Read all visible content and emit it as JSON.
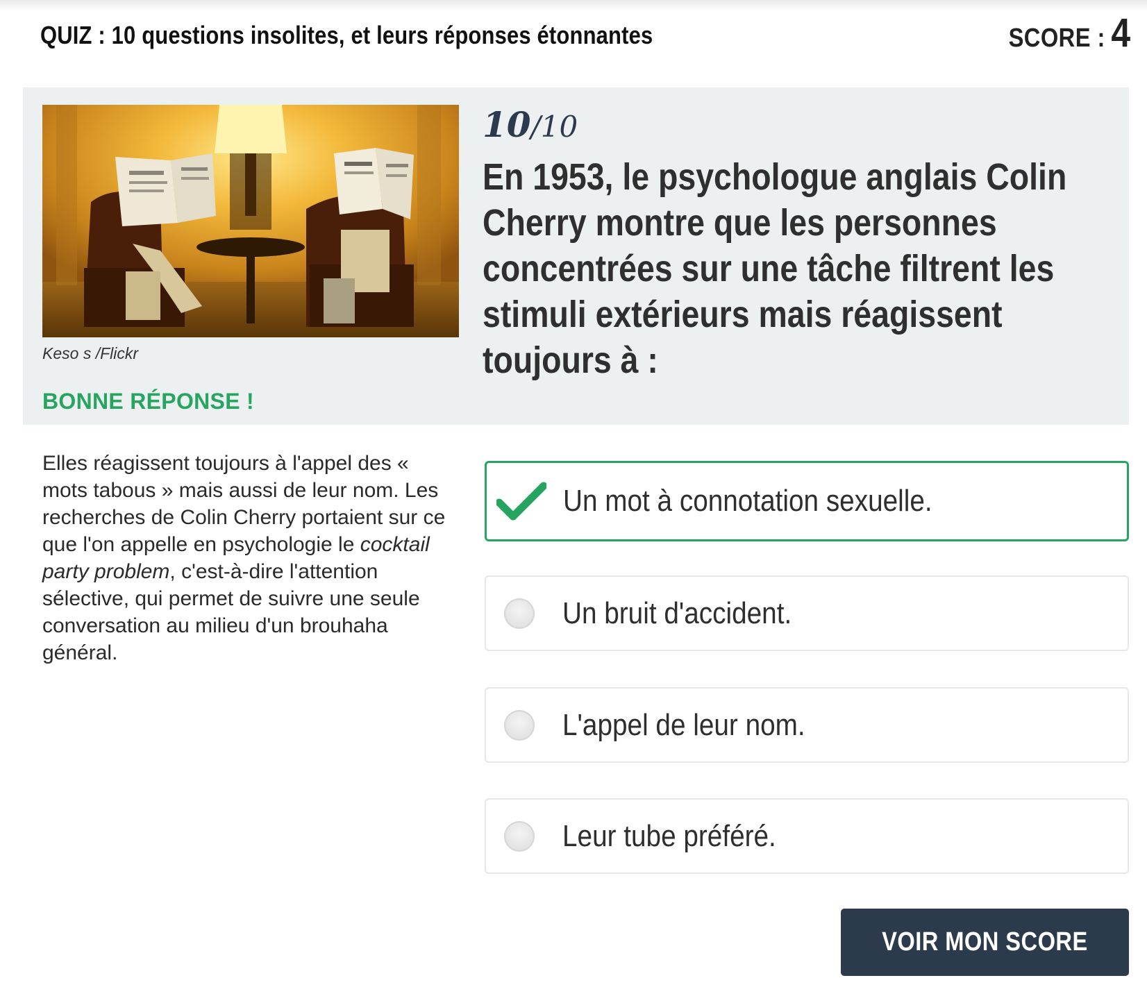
{
  "header": {
    "quiz_title": "QUIZ : 10 questions insolites, et leurs réponses étonnantes",
    "score_label": "SCORE :",
    "score_value": "4"
  },
  "question": {
    "number": "10",
    "total": "/10",
    "text": "En 1953, le psychologue anglais Colin Cherry montre que les personnes concentrées sur une tâche filtrent les stimuli extérieurs mais réagissent toujours à :",
    "image_credit": "Keso s /Flickr",
    "feedback": "BONNE RÉPONSE !"
  },
  "explanation": {
    "part1": "Elles réagissent toujours à l'appel des « mots tabous » mais aussi de leur nom. Les recherches de Colin Cherry portaient sur ce que l'on appelle en psychologie le ",
    "emphasis": "cocktail party problem",
    "part2": ", c'est-à-dire l'attention sélective, qui permet de suivre une seule conversation au milieu d'un brouhaha général."
  },
  "answers": [
    {
      "label": "Un mot à connotation sexuelle.",
      "state": "correct",
      "icon": "checkmark-icon"
    },
    {
      "label": "Un bruit d'accident.",
      "state": "unselected",
      "icon": "radio-icon"
    },
    {
      "label": "L'appel de leur nom.",
      "state": "unselected",
      "icon": "radio-icon"
    },
    {
      "label": "Leur tube préféré.",
      "state": "unselected",
      "icon": "radio-icon"
    }
  ],
  "actions": {
    "see_score_label": "VOIR MON SCORE"
  },
  "colors": {
    "correct_green": "#27a560",
    "button_navy": "#2c3b4c",
    "panel_gray": "#edf0f1",
    "progress_navy": "#2b3a4e"
  }
}
